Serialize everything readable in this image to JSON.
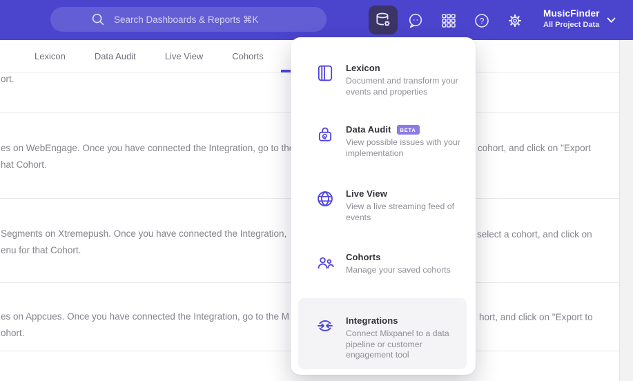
{
  "topbar": {
    "search_placeholder": "Search Dashboards & Reports ⌘K",
    "project": {
      "name": "MusicFinder",
      "scope": "All Project Data"
    }
  },
  "tabbar": {
    "tabs": [
      {
        "label": "Lexicon"
      },
      {
        "label": "Data Audit"
      },
      {
        "label": "Live View"
      },
      {
        "label": "Cohorts"
      }
    ]
  },
  "menu": {
    "items": [
      {
        "icon": "lexicon-book-icon",
        "label": "Lexicon",
        "description": "Document and transform your events and properties"
      },
      {
        "icon": "data-audit-lock-icon",
        "label": "Data Audit",
        "badge": "BETA",
        "description": "View possible issues with your implementation"
      },
      {
        "icon": "live-view-globe-icon",
        "label": "Live View",
        "description": "View a live streaming feed of events"
      },
      {
        "icon": "cohorts-people-icon",
        "label": "Cohorts",
        "description": "Manage your saved cohorts"
      },
      {
        "icon": "integrations-sync-icon",
        "label": "Integrations",
        "description": "Connect Mixpanel to a data pipeline or customer engagement tool",
        "highlighted": true
      }
    ]
  },
  "background": {
    "rows": [
      {
        "l1": "ort.",
        "l2": "",
        "r": ""
      },
      {
        "l1": "es on WebEngage. Once you have connected the Integration, go to the",
        "l2": "hat Cohort.",
        "r": "cohort, and click on \"Export"
      },
      {
        "l1": "Segments on Xtremepush. Once you have connected the Integration,",
        "l2": "enu for that Cohort.",
        "r": "select a cohort, and click on"
      },
      {
        "l1": "es on Appcues. Once you have connected the Integration, go to the M",
        "l2": "ohort.",
        "r": "hort, and click on \"Export to"
      }
    ]
  },
  "colors": {
    "topbar": "#4b44cd",
    "accent": "#4f44e0",
    "badge": "#8b7be8",
    "highlight": "#f4f4f6"
  }
}
